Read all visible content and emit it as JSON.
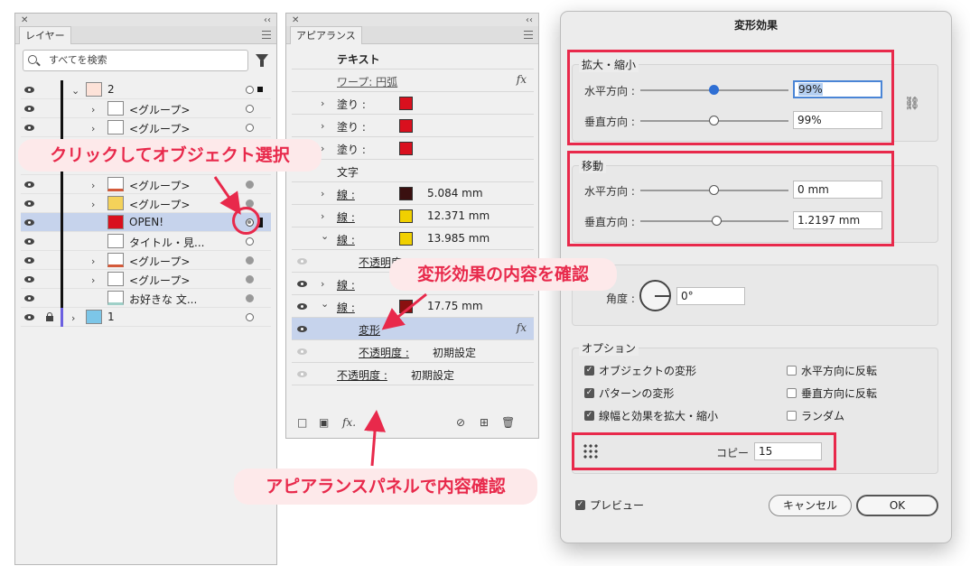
{
  "layers_panel": {
    "tab": "レイヤー",
    "search_placeholder": "すべてを検索",
    "rows": [
      {
        "name": "2"
      },
      {
        "name": "<グループ>"
      },
      {
        "name": "<グループ>"
      },
      {
        "name": "<グループ>"
      },
      {
        "name": "<グループ>"
      },
      {
        "name": "OPEN!"
      },
      {
        "name": "タイトル・見..."
      },
      {
        "name": "<グループ>"
      },
      {
        "name": "<グループ>"
      },
      {
        "name": "お好きな 文..."
      },
      {
        "name": "1"
      }
    ]
  },
  "appearance_panel": {
    "tab": "アピアランス",
    "header": "テキスト",
    "warp": "ワープ: 円弧",
    "fill_label": "塗り :",
    "type_label": "文字",
    "stroke_label": "線 :",
    "stroke1": "5.084 mm",
    "stroke2": "12.371 mm",
    "stroke3": "13.985 mm",
    "opacity_partial": "不透明度",
    "stroke5": "17.75 mm",
    "transform": "変形",
    "opacity_label": "不透明度 :",
    "opacity_value": "初期設定",
    "opacity2_label": "不透明度 :",
    "opacity2_value": "初期設定",
    "fx": "fx",
    "fx_bottom": "fx."
  },
  "dialog": {
    "title": "変形効果",
    "scale_group": "拡大・縮小",
    "horizontal": "水平方向 :",
    "vertical": "垂直方向 :",
    "scale_h": "99%",
    "scale_v": "99%",
    "move_group": "移動",
    "move_h": "0 mm",
    "move_v": "1.2197 mm",
    "angle_label": "角度 :",
    "angle_value": "0°",
    "options_group": "オプション",
    "opt_objects": "オブジェクトの変形",
    "opt_patterns": "パターンの変形",
    "opt_strokes": "線幅と効果を拡大・縮小",
    "opt_reflect_x": "水平方向に反転",
    "opt_reflect_y": "垂直方向に反転",
    "opt_random": "ランダム",
    "copies_label": "コピー",
    "copies_value": "15",
    "preview": "プレビュー",
    "cancel": "キャンセル",
    "ok": "OK"
  },
  "callouts": {
    "click_select": "クリックしてオブジェクト選択",
    "check_transform": "変形効果の内容を確認",
    "check_appearance": "アピアランスパネルで内容確認"
  },
  "colors": {
    "accent_red": "#e8294b",
    "callout_bg": "#fde9ea",
    "selection": "#c6d3ec",
    "swatch_red": "#d9101e",
    "swatch_dark": "#3a1010",
    "swatch_yellow": "#f0d000"
  }
}
